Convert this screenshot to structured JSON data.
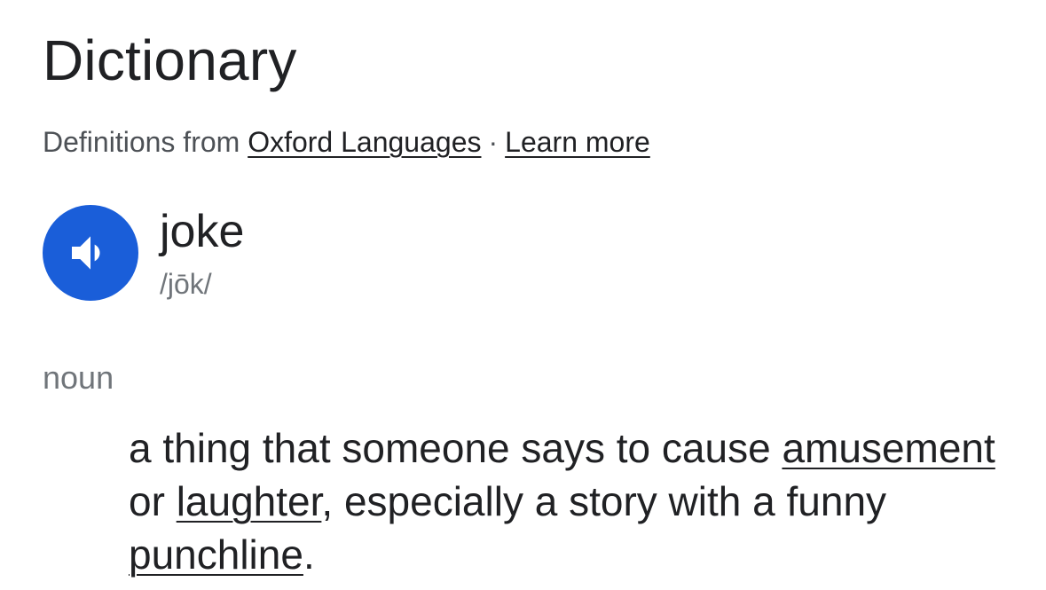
{
  "header": {
    "title": "Dictionary"
  },
  "source": {
    "prefix": "Definitions from",
    "provider_link": "Oxford Languages",
    "separator": "·",
    "learn_more_link": "Learn more"
  },
  "entry": {
    "speaker_icon": "volume-up-icon",
    "accent_color": "#1a5ed9",
    "word": "joke",
    "phonetic": "/jōk/",
    "part_of_speech": "noun",
    "definition": {
      "part1": "a thing that someone says to cause ",
      "link1": "amusement",
      "part2": " or ",
      "link2": "laughter",
      "part3": ", especially a story with a funny ",
      "link3": "punchline",
      "part4": "."
    }
  }
}
